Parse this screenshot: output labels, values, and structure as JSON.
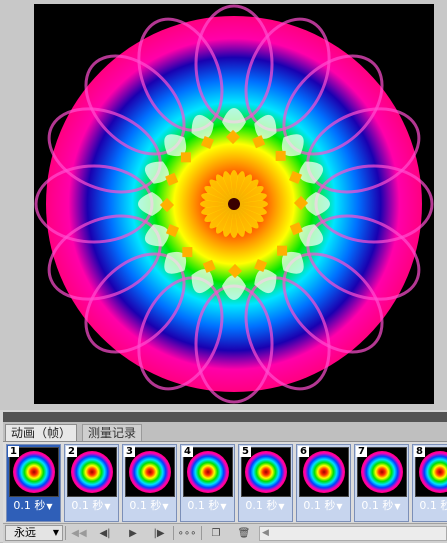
{
  "panel": {
    "tabs": [
      {
        "label": "动画（帧）",
        "active": true
      },
      {
        "label": "测量记录",
        "active": false
      }
    ]
  },
  "frames": [
    {
      "number": "1",
      "delay": "0.1 秒",
      "selected": true
    },
    {
      "number": "2",
      "delay": "0.1 秒",
      "selected": false
    },
    {
      "number": "3",
      "delay": "0.1 秒",
      "selected": false
    },
    {
      "number": "4",
      "delay": "0.1 秒",
      "selected": false
    },
    {
      "number": "5",
      "delay": "0.1 秒",
      "selected": false
    },
    {
      "number": "6",
      "delay": "0.1 秒",
      "selected": false
    },
    {
      "number": "7",
      "delay": "0.1 秒",
      "selected": false
    },
    {
      "number": "8",
      "delay": "0.1 秒",
      "selected": false
    }
  ],
  "toolbar": {
    "loop_value": "永远",
    "buttons": [
      {
        "name": "first-frame-button",
        "icon": "first-frame-icon",
        "glyph": "◀◀",
        "disabled": true
      },
      {
        "name": "prev-frame-button",
        "icon": "prev-frame-icon",
        "glyph": "◀|",
        "disabled": false
      },
      {
        "name": "play-button",
        "icon": "play-icon",
        "glyph": "▶",
        "disabled": false
      },
      {
        "name": "next-frame-button",
        "icon": "next-frame-icon",
        "glyph": "|▶",
        "disabled": false
      },
      {
        "name": "tween-button",
        "icon": "tween-icon",
        "glyph": "∘∘∘",
        "disabled": false
      },
      {
        "name": "duplicate-frame-button",
        "icon": "duplicate-frame-icon",
        "glyph": "❐",
        "disabled": false
      },
      {
        "name": "delete-frame-button",
        "icon": "trash-icon",
        "glyph": "🗑",
        "disabled": false
      }
    ]
  },
  "colors": {
    "canvas_bg": "#000000",
    "selected_frame": "#2f5fb8",
    "panel_bg": "#d6d6d6"
  }
}
